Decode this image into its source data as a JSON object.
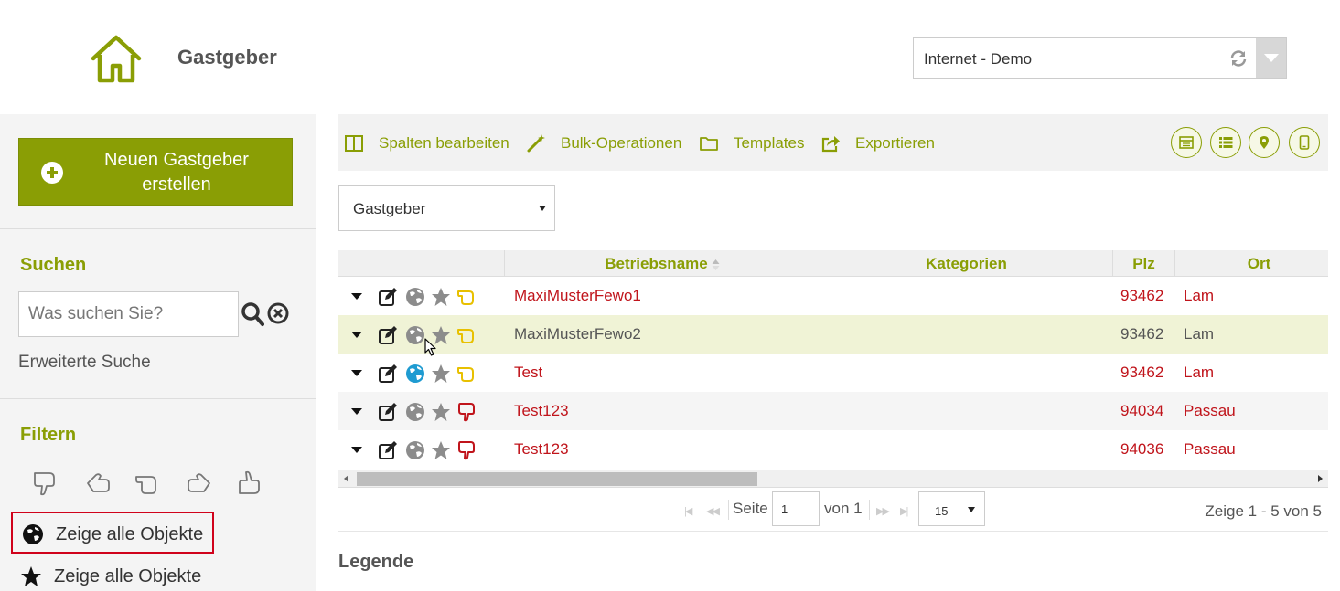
{
  "header": {
    "title": "Gastgeber",
    "client_select": {
      "value": "Internet - Demo"
    }
  },
  "sidebar": {
    "new_button_label": "Neuen Gastgeber erstellen",
    "search": {
      "title": "Suchen",
      "placeholder": "Was suchen Sie?",
      "advanced_label": "Erweiterte Suche"
    },
    "filter": {
      "title": "Filtern",
      "icons": [
        "thumb-down-icon",
        "thumb-left-icon",
        "thumb-sideways-icon",
        "thumb-right-icon",
        "thumb-up-icon"
      ],
      "options": [
        {
          "icon": "globe-icon",
          "label": "Zeige alle Objekte",
          "highlighted": true
        },
        {
          "icon": "star-icon",
          "label": "Zeige alle Objekte",
          "highlighted": false
        }
      ]
    }
  },
  "toolbar": {
    "items": [
      {
        "icon": "columns-icon",
        "label": "Spalten bearbeiten"
      },
      {
        "icon": "magic-wand-icon",
        "label": "Bulk-Operationen"
      },
      {
        "icon": "folder-icon",
        "label": "Templates"
      },
      {
        "icon": "export-icon",
        "label": "Exportieren"
      }
    ],
    "view_buttons": [
      "table-view-icon",
      "list-view-icon",
      "map-view-icon",
      "mobile-view-icon"
    ]
  },
  "type_select": {
    "value": "Gastgeber"
  },
  "grid": {
    "columns": [
      "Betriebsname",
      "Kategorien",
      "Plz",
      "Ort"
    ],
    "rows": [
      {
        "name": "MaxiMusterFewo1",
        "kategorien": "",
        "plz": "93462",
        "ort": "Lam",
        "globe_active": false,
        "rating": "neutral"
      },
      {
        "name": "MaxiMusterFewo2",
        "kategorien": "",
        "plz": "93462",
        "ort": "Lam",
        "globe_active": false,
        "rating": "neutral"
      },
      {
        "name": "Test",
        "kategorien": "",
        "plz": "93462",
        "ort": "Lam",
        "globe_active": true,
        "rating": "neutral"
      },
      {
        "name": "Test123",
        "kategorien": "",
        "plz": "94034",
        "ort": "Passau",
        "globe_active": false,
        "rating": "bad"
      },
      {
        "name": "Test123",
        "kategorien": "",
        "plz": "94036",
        "ort": "Passau",
        "globe_active": false,
        "rating": "bad"
      }
    ]
  },
  "pager": {
    "page_label": "Seite",
    "page_value": "1",
    "of_label": "von 1",
    "page_size": "15",
    "summary": "Zeige 1 - 5 von 5"
  },
  "legend_title": "Legende",
  "colors": {
    "accent": "#8a9e05",
    "link_red": "#c0141b",
    "highlight_row": "#f0f3d6",
    "globe_active": "#1f9bd1",
    "rating_neutral": "#e8c000",
    "rating_bad": "#c0141b"
  }
}
